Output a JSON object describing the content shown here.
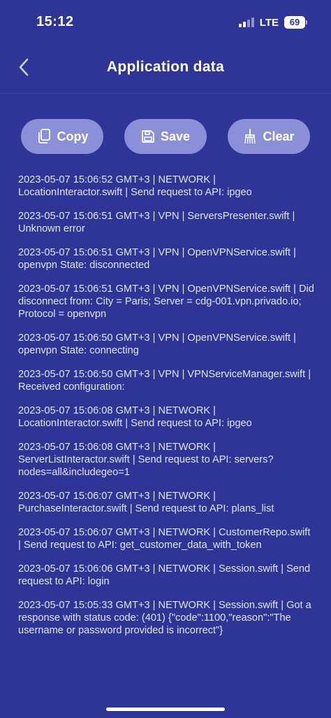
{
  "status": {
    "time": "15:12",
    "network": "LTE",
    "battery": "69"
  },
  "nav": {
    "title": "Application data",
    "back_icon": "chevron-left-icon"
  },
  "actions": {
    "copy_label": "Copy",
    "save_label": "Save",
    "clear_label": "Clear",
    "copy_icon": "copy-icon",
    "save_icon": "floppy-disk-icon",
    "clear_icon": "broom-icon"
  },
  "colors": {
    "background": "#2e3596",
    "button": "#8a8fd8",
    "text": "#ffffff"
  },
  "logs": [
    "2023-05-07 15:06:52 GMT+3 | NETWORK | LocationInteractor.swift | Send request to API:  ipgeo",
    "2023-05-07 15:06:51 GMT+3 | VPN | ServersPresenter.swift | Unknown error",
    "2023-05-07 15:06:51 GMT+3 | VPN | OpenVPNService.swift | openvpn State: disconnected",
    "2023-05-07 15:06:51 GMT+3 | VPN | OpenVPNService.swift | Did disconnect from:  City = Paris; Server = cdg-001.vpn.privado.io; Protocol = openvpn",
    "2023-05-07 15:06:50 GMT+3 | VPN | OpenVPNService.swift | openvpn State: connecting",
    "2023-05-07 15:06:50 GMT+3 | VPN | VPNServiceManager.swift | Received configuration:",
    "2023-05-07 15:06:08 GMT+3 | NETWORK | LocationInteractor.swift | Send request to API:  ipgeo",
    "2023-05-07 15:06:08 GMT+3 | NETWORK | ServerListInteractor.swift | Send request to API:  servers?nodes=all&includegeo=1",
    "2023-05-07 15:06:07 GMT+3 | NETWORK | PurchaseInteractor.swift | Send request to API:  plans_list",
    "2023-05-07 15:06:07 GMT+3 | NETWORK | CustomerRepo.swift | Send request to API:  get_customer_data_with_token",
    "2023-05-07 15:06:06 GMT+3 | NETWORK | Session.swift | Send request to API:  login",
    "2023-05-07 15:05:33 GMT+3 | NETWORK | Session.swift | Got a response with status code:  (401) {\"code\":1100,\"reason\":\"The username or password provided is incorrect\"}"
  ]
}
